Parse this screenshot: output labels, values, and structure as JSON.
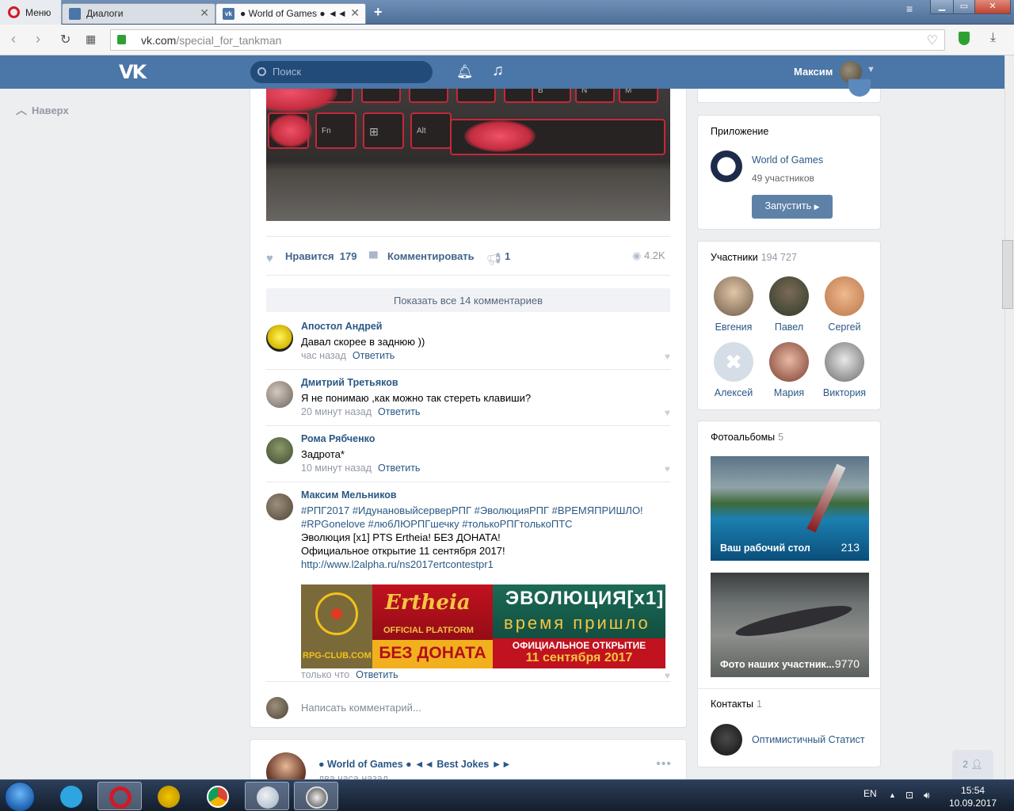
{
  "browser": {
    "menu_label": "Меню",
    "tabs": [
      {
        "title": "Диалоги"
      },
      {
        "title": "● World of Games ● ◄◄ "
      }
    ],
    "url_host": "vk.com",
    "url_path": "/special_for_tankman"
  },
  "header": {
    "logo": "VK",
    "search_placeholder": "Поиск",
    "user_name": "Максим"
  },
  "left": {
    "back_to_top": "Наверх"
  },
  "post": {
    "actions": {
      "like_label": "Нравится",
      "like_count": "179",
      "comment_label": "Комментировать",
      "share_count": "1",
      "views": "4.2K"
    },
    "show_all_comments": "Показать все 14 комментариев",
    "reply_label": "Ответить",
    "comments": [
      {
        "author": "Апостол Андрей",
        "text": "Давал скорее в заднюю ))",
        "time": "час назад"
      },
      {
        "author": "Дмитрий Третьяков",
        "text": "Я не понимаю ,как можно так стереть клавиши?",
        "time": "20 минут назад"
      },
      {
        "author": "Рома Рябченко",
        "text": "Задрота*",
        "time": "10 минут назад"
      },
      {
        "author": "Максим Мельников",
        "hashtags1": "#РПГ2017 #ИдунановыйсерверРПГ #ЭволюцияРПГ #ВРЕМЯПРИШЛО!",
        "hashtags2": "#RPGonelove #любЛЮРПГшечку #толькоРПГтолькоПТС",
        "line1": "Эволюция [x1] PTS Ertheia! БЕЗ ДОНАТА!",
        "line2": "Официальное открытие 11 сентября 2017!",
        "link": "http://www.l2alpha.ru/ns2017ertcontestpr1",
        "time": "только что"
      }
    ],
    "banner": {
      "left_brand": "RPG-CLUB.COM",
      "logo_text": "Ertheia",
      "official": "OFFICIAL PLATFORM",
      "no_donate": "БЕЗ ДОНАТА",
      "evolution": "ЭВОЛЮЦИЯ[x1]",
      "time_came": "время пришло",
      "opening": "ОФИЦИАЛЬНОЕ ОТКРЫТИЕ",
      "date": "11 сентября 2017"
    },
    "write_placeholder": "Написать комментарий..."
  },
  "post2": {
    "author": "● World of Games ● ◄◄ Best Jokes ►►",
    "time": "два часа назад"
  },
  "sidebar": {
    "app": {
      "title": "Приложение",
      "name": "World of Games",
      "members": "49 участников",
      "launch": "Запустить"
    },
    "members": {
      "title": "Участники",
      "count": "194 727",
      "list": [
        "Евгения",
        "Павел",
        "Сергей",
        "Алексей",
        "Мария",
        "Виктория"
      ]
    },
    "albums": {
      "title": "Фотоальбомы",
      "count": "5",
      "list": [
        {
          "name": "Ваш рабочий стол",
          "count": "213"
        },
        {
          "name": "Фото наших участник...",
          "count": "9770"
        }
      ]
    },
    "contacts": {
      "title": "Контакты",
      "count": "1",
      "name": "Оптимистичный Статист"
    },
    "friends_online": "2"
  },
  "taskbar": {
    "lang": "EN",
    "time": "15:54",
    "date": "10.09.2017"
  }
}
